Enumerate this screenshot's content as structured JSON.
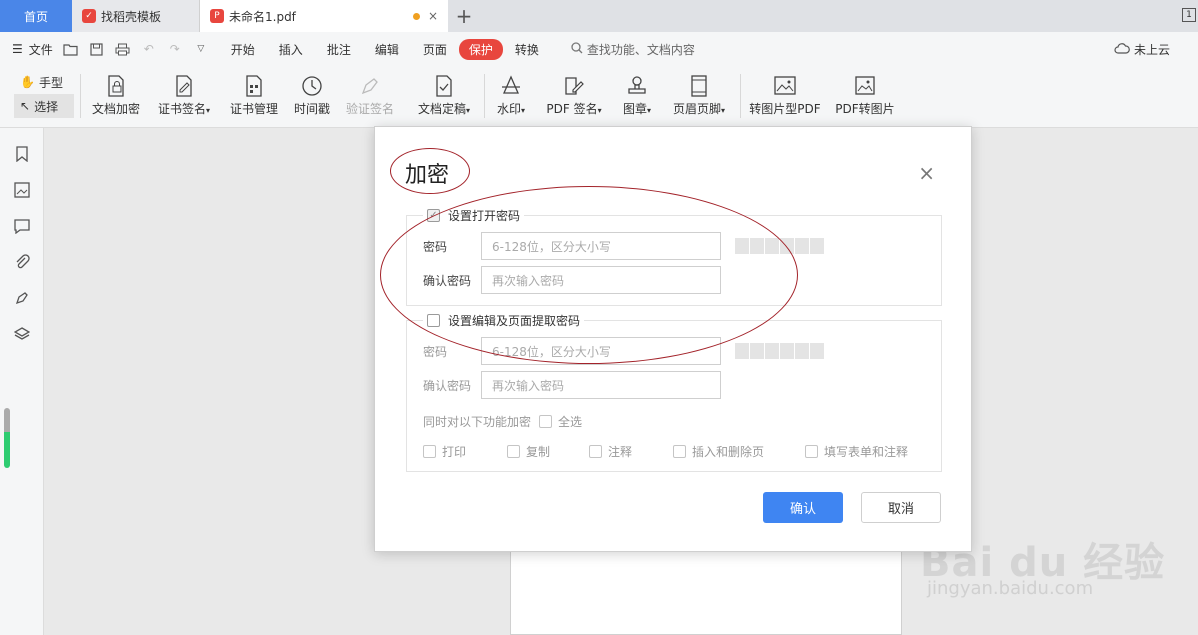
{
  "tabs": {
    "home": "首页",
    "template": "找稻壳模板",
    "doc": "未命名1.pdf",
    "close": "×",
    "plus": "+"
  },
  "menu": {
    "file": "文件",
    "tabs": [
      "开始",
      "插入",
      "批注",
      "编辑",
      "页面",
      "保护",
      "转换"
    ],
    "active_tab": "保护",
    "search": "查找功能、文档内容",
    "cloud": "未上云"
  },
  "ribbon": {
    "hand": "手型",
    "select": "选择",
    "tools": [
      "文档加密",
      "证书签名",
      "证书管理",
      "时间戳",
      "验证签名",
      "文档定稿",
      "水印",
      "PDF 签名",
      "图章",
      "页眉页脚",
      "转图片型PDF",
      "PDF转图片"
    ]
  },
  "dialog": {
    "title": "加密",
    "close": "×",
    "group1": {
      "legend": "设置打开密码",
      "password_label": "密码",
      "password_placeholder": "6-128位，区分大小写",
      "confirm_label": "确认密码",
      "confirm_placeholder": "再次输入密码"
    },
    "group2": {
      "legend": "设置编辑及页面提取密码",
      "password_label": "密码",
      "password_placeholder": "6-128位，区分大小写",
      "confirm_label": "确认密码",
      "confirm_placeholder": "再次输入密码",
      "encrypt_label": "同时对以下功能加密",
      "select_all": "全选",
      "options": [
        "打印",
        "复制",
        "注释",
        "插入和删除页",
        "填写表单和注释"
      ]
    },
    "ok": "确认",
    "cancel": "取消"
  },
  "watermark": {
    "logo": "Bai du 经验",
    "site": "jingyan.baidu.com"
  },
  "colors": {
    "accent": "#3f85f2",
    "protect_tab": "#e8463e",
    "annotation": "#a3232a"
  }
}
